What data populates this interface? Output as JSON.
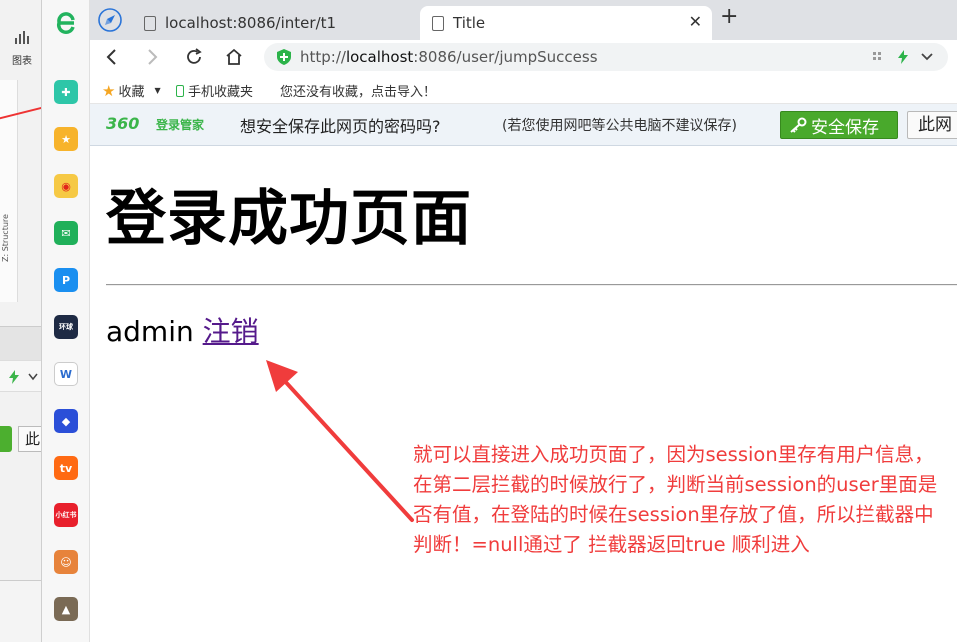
{
  "background_window": {
    "chart_label": "图表",
    "structure_label": "Z: Structure",
    "button_fragment": "此"
  },
  "tabs": [
    {
      "title": "localhost:8086/inter/t1",
      "active": false
    },
    {
      "title": "Title",
      "active": true
    }
  ],
  "address": {
    "scheme": "http://",
    "host": "localhost",
    "rest": ":8086/user/jumpSuccess"
  },
  "bookmarks": {
    "favorites": "收藏",
    "mobile": "手机收藏夹",
    "empty_hint": "您还没有收藏，点击导入！"
  },
  "password_bar": {
    "brand": "360",
    "brand_sub": "登录管家",
    "question": "想安全保存此网页的密码吗?",
    "hint": "(若您使用网吧等公共电脑不建议保存)",
    "save_label": "安全保存",
    "dismiss_label": "此网"
  },
  "page": {
    "heading": "登录成功页面",
    "username": "admin",
    "logout_link": "注销"
  },
  "annotation": {
    "text": "就可以直接进入成功页面了，因为session里存有用户信息，在第二层拦截的时候放行了，判断当前session的user里面是否有值，在登陆的时候在session里存放了值，所以拦截器中判断！=null通过了 拦截器返回true 顺利进入"
  },
  "colors": {
    "annotation_red": "#f03c3c",
    "save_green": "#49a92c",
    "brand_green": "#3bb54a",
    "link_visited": "#551a8b"
  }
}
